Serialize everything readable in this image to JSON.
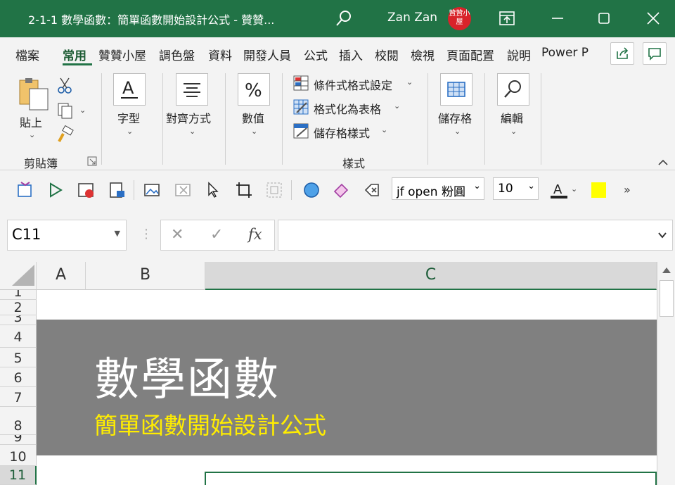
{
  "window": {
    "title": "2-1-1 數學函數：簡單函數開始設計公式 - 贊贊...",
    "user": "Zan Zan",
    "avatar_text": "贊贊小屋"
  },
  "tabs": [
    "檔案",
    "常用",
    "贊贊小屋",
    "調色盤",
    "資料",
    "開發人員",
    "公式",
    "插入",
    "校閱",
    "檢視",
    "頁面配置",
    "說明",
    "Power P"
  ],
  "active_tab": "常用",
  "ribbon": {
    "paste": "貼上",
    "clipboard": "剪貼簿",
    "font": "字型",
    "align": "對齊方式",
    "number": "數值",
    "cond_format": "條件式格式設定",
    "format_table": "格式化為表格",
    "cell_styles": "儲存格樣式",
    "styles": "樣式",
    "cells": "儲存格",
    "editing": "編輯"
  },
  "qat": {
    "font_name": "jf open 粉圓 ",
    "font_size": "10",
    "more": "»",
    "highlight_color": "#ffff00"
  },
  "formula_bar": {
    "name_box": "C11",
    "cancel": "✕",
    "enter": "✓",
    "fx": "fx",
    "formula": ""
  },
  "columns": [
    "A",
    "B",
    "C"
  ],
  "rows": [
    "1",
    "2",
    "3",
    "4",
    "5",
    "6",
    "7",
    "8",
    "9",
    "10",
    "11"
  ],
  "cells": {
    "title": "數學函數",
    "subtitle": "簡單函數開始設計公式"
  },
  "colors": {
    "accent": "#217346",
    "banner": "#808080",
    "subtitle": "#ffed00"
  }
}
